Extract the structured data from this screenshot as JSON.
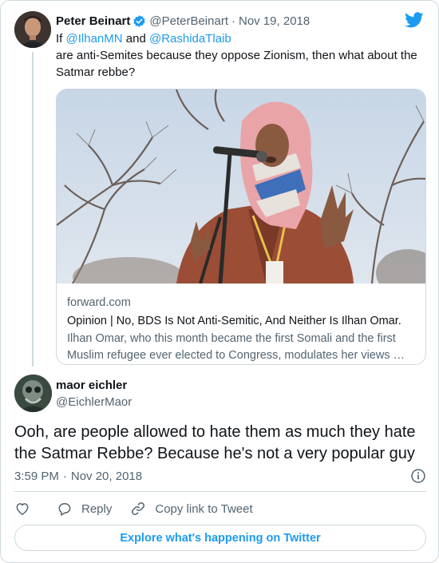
{
  "parent_tweet": {
    "author_name": "Peter Beinart",
    "author_handle": "@PeterBeinart",
    "separator": "·",
    "date": "Nov 19, 2018",
    "text_prefix": "If ",
    "mention_1": "@IlhanMN",
    "text_and": " and ",
    "mention_2": "@RashidaTlaib",
    "text_body": "are anti-Semites because they oppose Zionism, then what about the Satmar rebbe?",
    "link_card": {
      "domain": "forward.com",
      "title": "Opinion | No, BDS Is Not Anti-Semitic, And Neither Is Ilhan Omar.",
      "description": "Ilhan Omar, who this month became the first Somali and the first Muslim refugee ever elected to Congress, modulates her views …"
    }
  },
  "main_tweet": {
    "author_name": "maor eichler",
    "author_handle": "@EichlerMaor",
    "text": "Ooh, are people allowed to hate them as much they hate the Satmar Rebbe? Because he's not a very popular guy",
    "time": "3:59 PM",
    "separator": "·",
    "date": "Nov 20, 2018"
  },
  "actions": {
    "like_icon": "heart-icon",
    "reply_label": "Reply",
    "copy_link_label": "Copy link to Tweet"
  },
  "explore_label": "Explore what's happening on Twitter",
  "colors": {
    "accent": "#1d9bf0",
    "text_primary": "#0f1419",
    "text_secondary": "#536471",
    "border": "#cfd9de"
  }
}
